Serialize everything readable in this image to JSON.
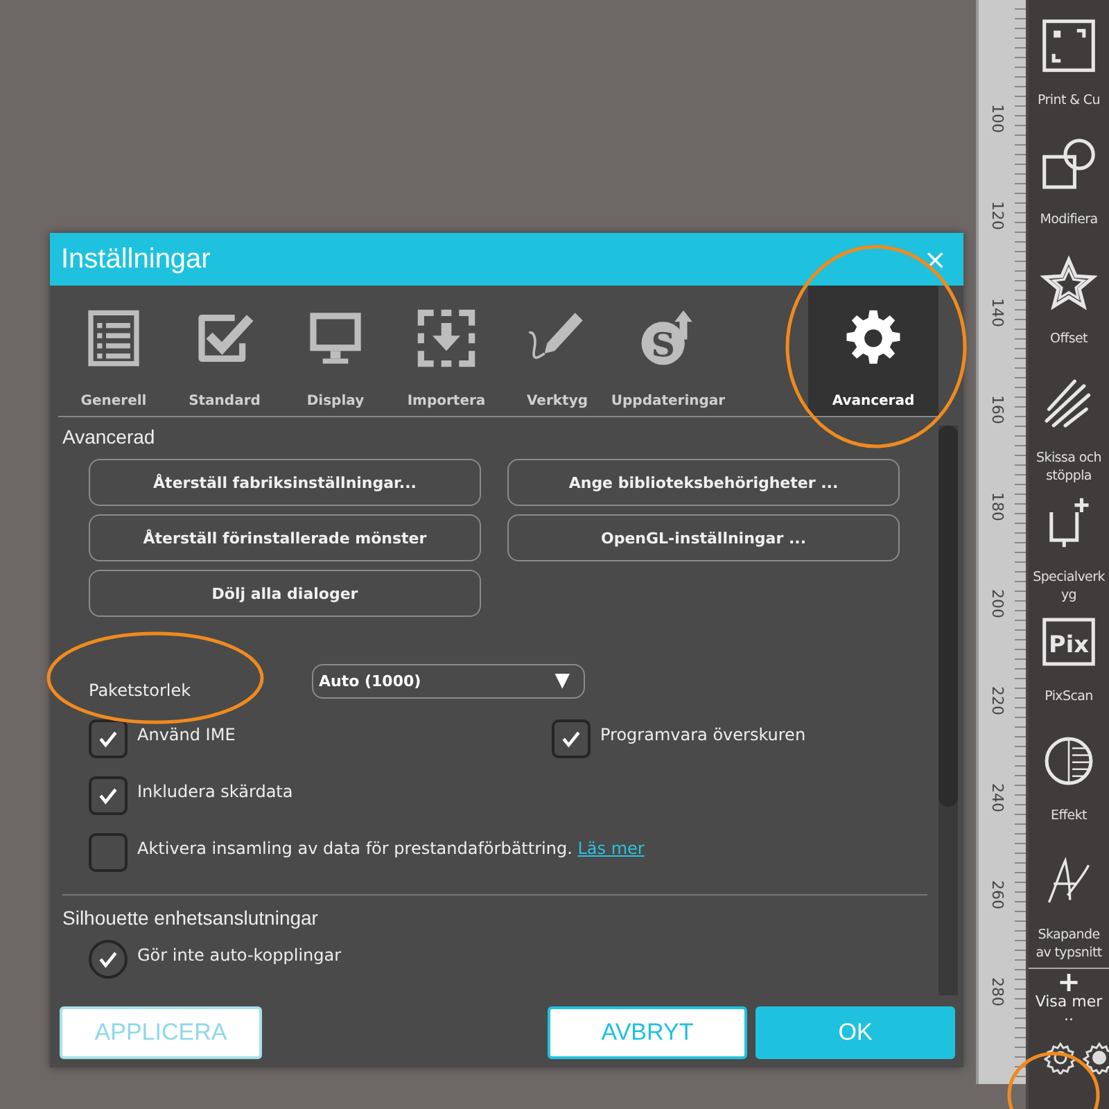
{
  "ruler": {
    "labels": [
      "100",
      "120",
      "140",
      "160",
      "180",
      "200",
      "220",
      "240",
      "260",
      "280"
    ]
  },
  "sidebar": {
    "items": [
      {
        "kind": "print-cut",
        "lines": [
          "Print & Cu"
        ]
      },
      {
        "kind": "modify",
        "lines": [
          "Modifiera"
        ]
      },
      {
        "kind": "offset",
        "lines": [
          "Offset"
        ]
      },
      {
        "kind": "sketch",
        "lines": [
          "Skissa och",
          "stöppla"
        ]
      },
      {
        "kind": "special",
        "lines": [
          "Specialverk",
          "yg"
        ]
      },
      {
        "kind": "pixscan",
        "icon_text": "Pix",
        "lines": [
          "PixScan"
        ]
      },
      {
        "kind": "effect",
        "lines": [
          "Effekt"
        ]
      },
      {
        "kind": "font",
        "lines": [
          "Skapande",
          "av typsnitt"
        ]
      }
    ],
    "more": {
      "icon": "+",
      "label": "Visa mer",
      "dots": ".."
    }
  },
  "dialog": {
    "title": "Inställningar",
    "close": "×",
    "tabs": [
      {
        "kind": "general",
        "label": "Generell",
        "selected": false
      },
      {
        "kind": "standard",
        "label": "Standard",
        "selected": false
      },
      {
        "kind": "display",
        "label": "Display",
        "selected": false
      },
      {
        "kind": "import",
        "label": "Importera",
        "selected": false
      },
      {
        "kind": "tools",
        "label": "Verktyg",
        "selected": false
      },
      {
        "kind": "updates",
        "icon_text": "S",
        "label": "Uppdateringar",
        "selected": false
      },
      {
        "kind": "advanced",
        "label": "Avancerad",
        "selected": true
      }
    ],
    "section_title": "Avancerad",
    "buttons": [
      "Återställ fabriksinställningar...",
      "Ange biblioteksbehörigheter ...",
      "Återställ förinstallerade mönster",
      "OpenGL-inställningar ...",
      "Dölj alla dialoger"
    ],
    "package_size": {
      "label": "Paketstorlek",
      "value": "Auto (1000)",
      "arrow": "▼"
    },
    "options": [
      {
        "label": "Använd IME",
        "checked": true
      },
      {
        "label": "Programvara överskuren",
        "checked": true
      },
      {
        "label": "Inkludera skärdata",
        "checked": true
      },
      {
        "label": "Aktivera insamling av data för prestandaförbättring.",
        "link": "Läs mer",
        "checked": false
      }
    ],
    "connections": {
      "title": "Silhouette enhetsanslutningar",
      "options": [
        {
          "label": "Gör inte auto-kopplingar",
          "checked": true
        }
      ]
    },
    "footer": [
      {
        "kind": "apply",
        "label": "APPLICERA",
        "disabled": true
      },
      {
        "kind": "cancel",
        "label": "AVBRYT",
        "disabled": false
      },
      {
        "kind": "ok",
        "label": "OK",
        "disabled": false
      }
    ]
  }
}
